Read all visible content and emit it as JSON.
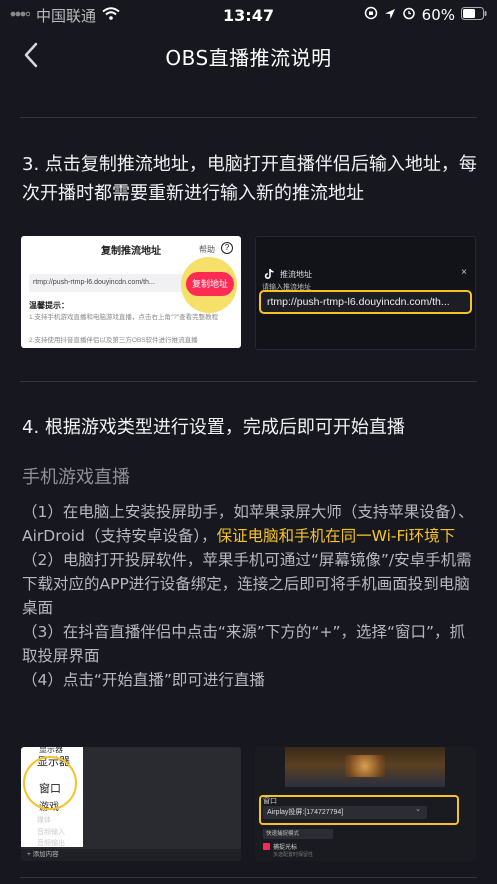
{
  "status": {
    "carrier": "中国联通",
    "time": "13:47",
    "battery": "60%"
  },
  "nav": {
    "title": "OBS直播推流说明"
  },
  "step3": {
    "title": "3. 点击复制推流地址，电脑打开直播伴侣后输入地址，每次开播时都需要重新进行输入新的推流地址"
  },
  "shot1": {
    "title": "复制推流地址",
    "help": "帮助",
    "url": "rtmp://push-rtmp-l6.douyincdn.com/th...",
    "copy_button": "复制地址",
    "tips_title": "温馨提示：",
    "tip1": "1.支持手机游戏直播和电脑游戏直播，点击右上角\"?\"查看完整教程",
    "tip2": "2.支持使用抖音直播伴侣以及第三方OBS软件进行推流直播"
  },
  "shot2": {
    "header": "推流地址",
    "label": "请输入推流地址",
    "url": "rtmp://push-rtmp-l6.douyincdn.com/th..."
  },
  "step4": {
    "title": "4. 根据游戏类型进行设置，完成后即可开始直播"
  },
  "mobile": {
    "subtitle": "手机游戏直播",
    "p1_a": "（1）在电脑上安装投屏助手，如苹果录屏大师（支持苹果设备）、AirDroid（支持安卓设备），",
    "p1_hl": "保证电脑和手机在同一Wi-Fi环境下",
    "p2": "（2）电脑打开投屏软件，苹果手机可通过“屏幕镜像”/安卓手机需下载对应的APP进行设备绑定，连接之后即可将手机画面投到电脑桌面",
    "p3": "（3）在抖音直播伴侣中点击“来源”下方的“+”，选择“窗口”，抓取投屏界面",
    "p4": "（4）点击“开始直播”即可进行直播"
  },
  "shot3": {
    "items": [
      "显示器",
      "窗口",
      "游戏",
      "媒体",
      "音频输入",
      "音频输出"
    ],
    "add": "+ 添加内容"
  },
  "shot4": {
    "section": "窗口",
    "select": "Airplay投屏:[174727794]",
    "mode": "快速捕捉模式",
    "checkbox": "捕捉光标",
    "note": "多选配置时保留性"
  },
  "colors": {
    "background": "#17181f",
    "accent_red": "#fe2c55",
    "highlight": "#f5c325"
  }
}
